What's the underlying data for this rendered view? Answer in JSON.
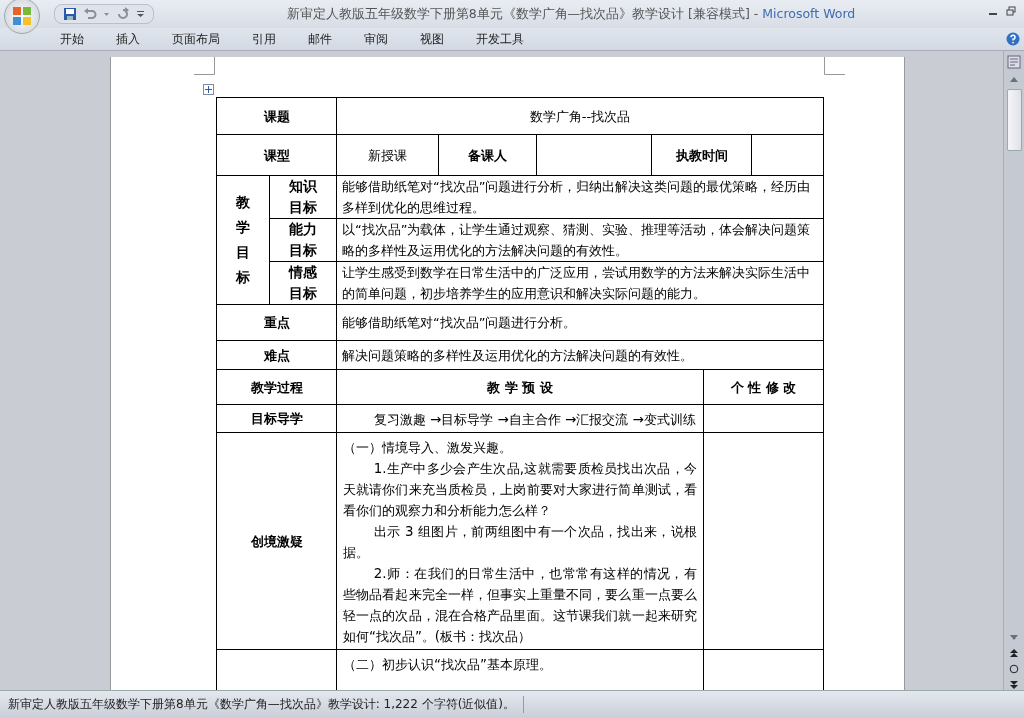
{
  "window": {
    "title": "新审定人教版五年级数学下册第8单元《数学广角—找次品》教学设计 [兼容模式] - ",
    "app_name": "Microsoft Word"
  },
  "ribbon_tabs": [
    "开始",
    "插入",
    "页面布局",
    "引用",
    "邮件",
    "审阅",
    "视图",
    "开发工具"
  ],
  "lesson_table": {
    "topic": {
      "label": "课题",
      "value": "数学广角--找次品"
    },
    "type_row": {
      "label": "课型",
      "value": "新授课",
      "preparer_label": "备课人",
      "time_label": "执教时间"
    },
    "goals": {
      "label": "教学目标",
      "items": [
        {
          "label": "知识目标",
          "text": "能够借助纸笔对“找次品”问题进行分析，归纳出解决这类问题的最优策略，经历由多样到优化的思维过程。"
        },
        {
          "label": "能力目标",
          "text": "以“找次品”为载体，让学生通过观察、猜测、实验、推理等活动，体会解决问题策略的多样性及运用优化的方法解决问题的有效性。"
        },
        {
          "label": "情感目标",
          "text": "让学生感受到数学在日常生活中的广泛应用，尝试用数学的方法来解决实际生活中的简单问题，初步培养学生的应用意识和解决实际问题的能力。"
        }
      ]
    },
    "key_point": {
      "label": "重点",
      "text": "能够借助纸笔对“找次品”问题进行分析。"
    },
    "difficulty": {
      "label": "难点",
      "text": "解决问题策略的多样性及运用优化的方法解决问题的有效性。"
    },
    "process_header": {
      "column_1": "教学过程",
      "column_2": "教 学 预 设",
      "column_3": "个 性 修 改"
    },
    "stages": [
      {
        "label": "目标导学",
        "paragraphs": [
          {
            "text": "复习激趣 →目标导学 →自主合作 →汇报交流 →变式训练",
            "indent": true
          }
        ]
      },
      {
        "label": "创境激疑",
        "paragraphs": [
          {
            "text": "（一）情境导入、激发兴趣。",
            "indent": false
          },
          {
            "text": "1.生产中多少会产生次品,这就需要质检员找出次品，今天就请你们来充当质检员，上岗前要对大家进行简单测试，看看你们的观察力和分析能力怎么样？",
            "indent": true
          },
          {
            "text": "出示 3 组图片，前两组图中有一个次品，找出来，说根据。",
            "indent": true
          },
          {
            "text": "2.师：在我们的日常生活中，也常常有这样的情况，有些物品看起来完全一样，但事实上重量不同，要么重一点要么轻一点的次品，混在合格产品里面。这节课我们就一起来研究如何“找次品”。(板书：找次品）",
            "indent": true
          }
        ]
      },
      {
        "paragraphs": [
          {
            "text": "（二）初步认识“找次品”基本原理。",
            "indent": false
          }
        ]
      }
    ]
  },
  "status_bar": {
    "text": "新审定人教版五年级数学下册第8单元《数学广角—找次品》教学设计: 1,222 个字符(近似值)。"
  }
}
